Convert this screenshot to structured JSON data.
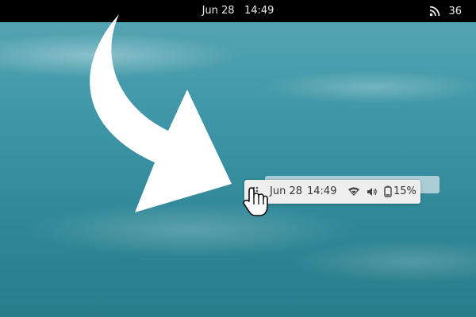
{
  "topbar": {
    "date": "Jun 28",
    "time": "14:49",
    "feed_icon": "rss-icon",
    "status_value": "36"
  },
  "panel": {
    "date": "Jun 28",
    "time": "14:49",
    "icons": [
      "wifi-icon",
      "volume-icon",
      "battery-icon"
    ],
    "battery_percent": "15%"
  },
  "colors": {
    "topbar_bg": "#000000",
    "panel_bg": "#eeeeee",
    "water": "#3f97a7"
  }
}
